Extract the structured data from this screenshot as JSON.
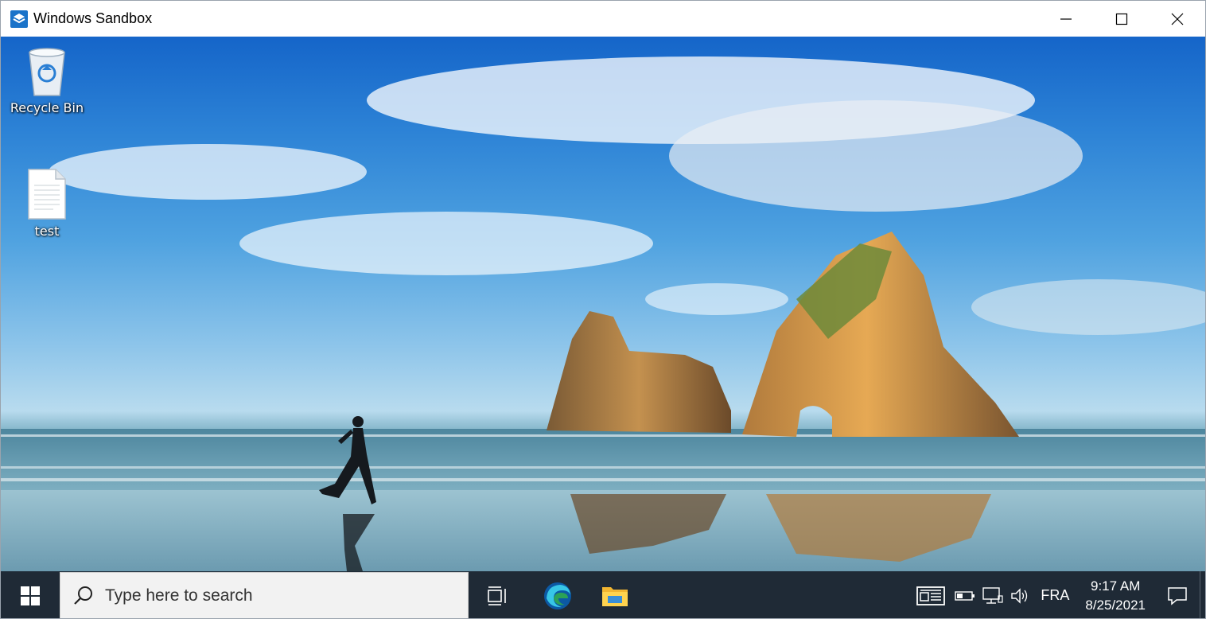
{
  "window": {
    "title": "Windows Sandbox"
  },
  "desktop": {
    "icons": [
      {
        "label": "Recycle Bin",
        "icon": "recycle-bin-icon"
      },
      {
        "label": "test",
        "icon": "text-file-icon"
      }
    ]
  },
  "taskbar": {
    "search_placeholder": "Type here to search",
    "pinned": [
      "task-view-icon",
      "edge-icon",
      "file-explorer-icon"
    ],
    "tray": {
      "language": "FRA",
      "time": "9:17 AM",
      "date": "8/25/2021"
    }
  },
  "colors": {
    "taskbar": "#1f2a36",
    "sky": "#2d83d6",
    "accent": "#0078d4"
  }
}
